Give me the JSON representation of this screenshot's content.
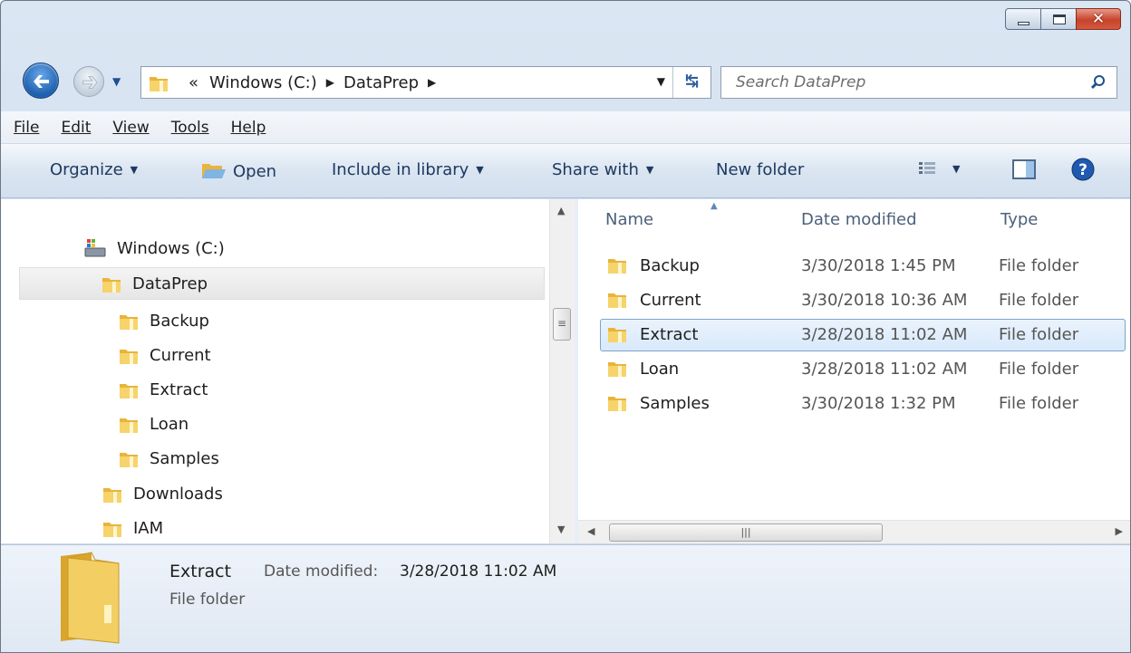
{
  "address": {
    "overflow": "«",
    "crumbs": [
      "Windows (C:)",
      "DataPrep"
    ]
  },
  "search": {
    "placeholder": "Search DataPrep"
  },
  "menu": [
    "File",
    "Edit",
    "View",
    "Tools",
    "Help"
  ],
  "toolbar": {
    "organize": "Organize",
    "open": "Open",
    "include": "Include in library",
    "share": "Share with",
    "new_folder": "New folder"
  },
  "tree": {
    "drive": "Windows (C:)",
    "selected": "DataPrep",
    "children": [
      "Backup",
      "Current",
      "Extract",
      "Loan",
      "Samples"
    ],
    "siblings": [
      "Downloads",
      "IAM"
    ]
  },
  "columns": {
    "name": "Name",
    "date": "Date modified",
    "type": "Type"
  },
  "files": [
    {
      "name": "Backup",
      "date": "3/30/2018 1:45 PM",
      "type": "File folder"
    },
    {
      "name": "Current",
      "date": "3/30/2018 10:36 AM",
      "type": "File folder"
    },
    {
      "name": "Extract",
      "date": "3/28/2018 11:02 AM",
      "type": "File folder"
    },
    {
      "name": "Loan",
      "date": "3/28/2018 11:02 AM",
      "type": "File folder"
    },
    {
      "name": "Samples",
      "date": "3/30/2018 1:32 PM",
      "type": "File folder"
    }
  ],
  "selected_index": 2,
  "details": {
    "name": "Extract",
    "date_label": "Date modified:",
    "date": "3/28/2018 11:02 AM",
    "type": "File folder"
  },
  "colors": {
    "folder": "#f0c64a",
    "selection_border": "#7da2ce",
    "accent": "#1d5fae"
  },
  "icons": [
    "back-icon",
    "forward-icon",
    "refresh-icon",
    "search-icon",
    "view-icon",
    "preview-pane-icon",
    "help-icon",
    "folder-icon",
    "drive-icon"
  ]
}
